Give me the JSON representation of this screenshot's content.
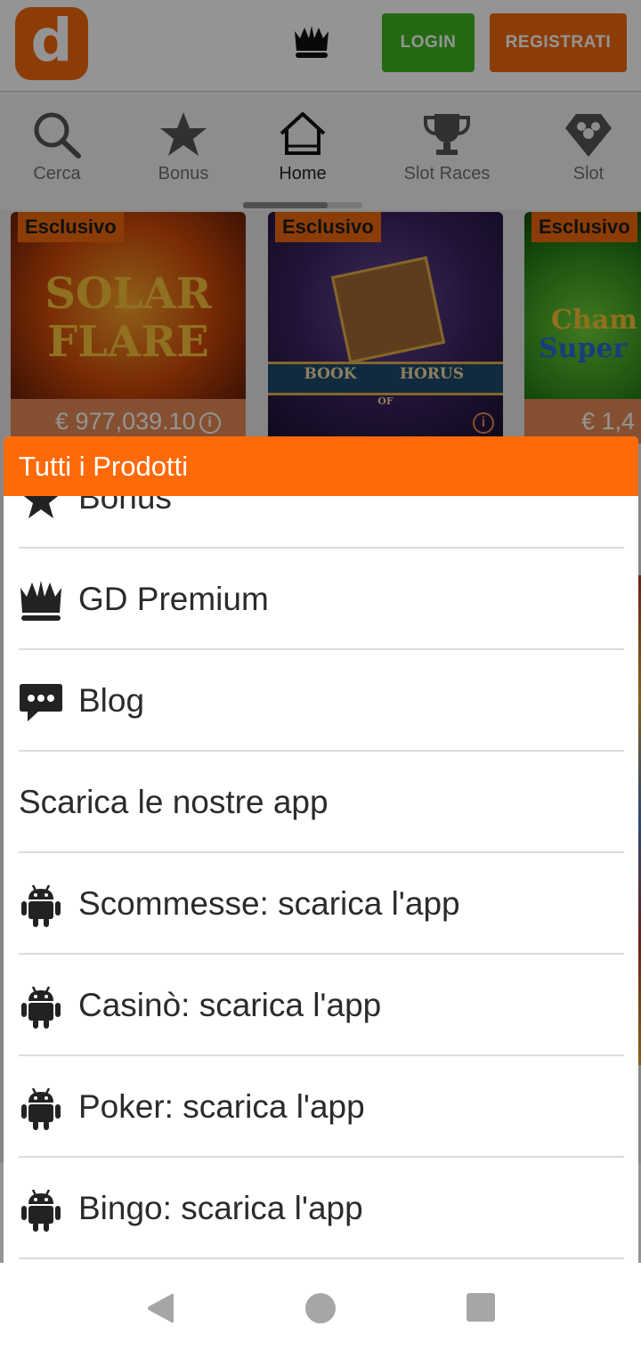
{
  "header": {
    "logo_letter": "d",
    "crown_icon": "crown-icon",
    "login_label": "LOGIN",
    "register_label": "REGISTRATI"
  },
  "nav": {
    "items": [
      {
        "label": "Cerca",
        "icon": "search-icon"
      },
      {
        "label": "Bonus",
        "icon": "star-icon"
      },
      {
        "label": "Home",
        "icon": "home-icon"
      },
      {
        "label": "Slot Races",
        "icon": "trophy-icon"
      },
      {
        "label": "Slot",
        "icon": "slot-diamond-icon"
      }
    ],
    "active": "Home"
  },
  "games": [
    {
      "badge": "Esclusivo",
      "title_line1": "SOLAR",
      "title_line2": "FLARE",
      "jackpot": "€ 977,039.10"
    },
    {
      "badge": "Esclusivo",
      "title_line1": "BOOK",
      "title_line2": "HORUS",
      "title_sub": "OF"
    },
    {
      "badge": "Esclusivo",
      "title_line1": "Cham",
      "title_line2": "Super",
      "jackpot": "€ 1,4"
    }
  ],
  "sheet": {
    "title": "Tutti i Prodotti",
    "items": [
      {
        "label": "Bonus",
        "icon": "star-icon"
      },
      {
        "label": "GD Premium",
        "icon": "crown-icon"
      },
      {
        "label": "Blog",
        "icon": "chat-bubble-icon"
      },
      {
        "label": "Scarica le nostre app",
        "icon": ""
      },
      {
        "label": "Scommesse: scarica l'app",
        "icon": "android-icon"
      },
      {
        "label": "Casinò: scarica l'app",
        "icon": "android-icon"
      },
      {
        "label": "Poker: scarica l'app",
        "icon": "android-icon"
      },
      {
        "label": "Bingo: scarica l'app",
        "icon": "android-icon"
      }
    ]
  },
  "system_nav": {
    "back_icon": "back-triangle-icon",
    "home_icon": "home-circle-icon",
    "recents_icon": "recents-square-icon"
  },
  "colors": {
    "brand_orange": "#ff6a08",
    "login_green": "#3fb51f"
  }
}
